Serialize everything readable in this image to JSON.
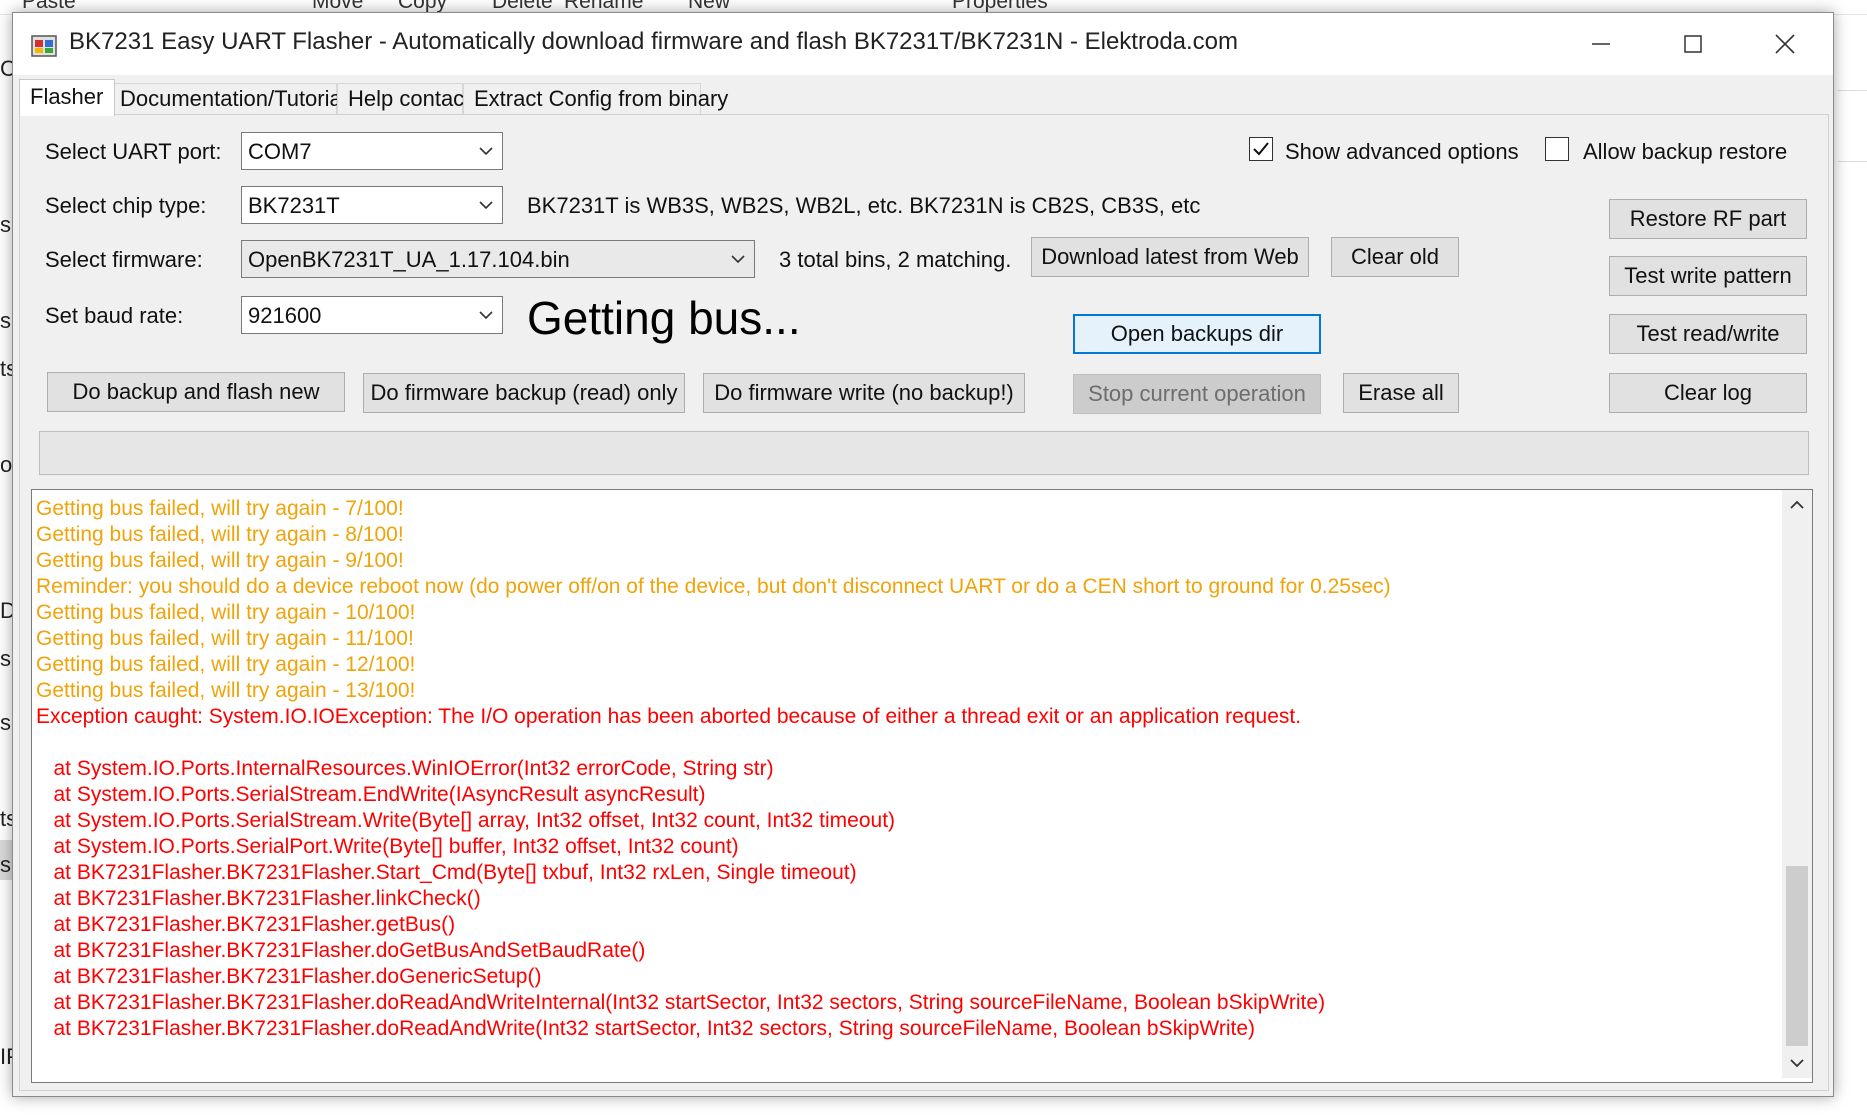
{
  "background": {
    "ribbon_items": [
      "Paste",
      "Move",
      "Copy",
      "Delete",
      "Rename",
      "New",
      "Properties"
    ],
    "left_fragments": [
      "Cl",
      "s",
      "s",
      "ts",
      "ol",
      "D",
      "s",
      "s",
      "ts",
      "s",
      "IP"
    ]
  },
  "window": {
    "title": "BK7231 Easy UART Flasher - Automatically download firmware and flash BK7231T/BK7231N  - Elektroda.com",
    "controls": {
      "minimize": "–",
      "maximize": "☐",
      "close": "✕"
    }
  },
  "tabs": [
    {
      "label": "Flasher",
      "active": true
    },
    {
      "label": "Documentation/Tutorials",
      "active": false
    },
    {
      "label": "Help contact",
      "active": false
    },
    {
      "label": "Extract Config from binary",
      "active": false
    }
  ],
  "form": {
    "uart_label": "Select UART port:",
    "uart_value": "COM7",
    "chip_label": "Select chip type:",
    "chip_value": "BK7231T",
    "chip_info": "BK7231T is WB3S, WB2S, WB2L, etc. BK7231N is CB2S, CB3S, etc",
    "firmware_label": "Select firmware:",
    "firmware_value": "OpenBK7231T_UA_1.17.104.bin",
    "bins_info": "3 total bins, 2 matching.",
    "baud_label": "Set baud rate:",
    "baud_value": "921600",
    "status_text": "Getting bus..."
  },
  "options": {
    "show_advanced": {
      "label": "Show advanced options",
      "checked": true
    },
    "allow_restore": {
      "label": "Allow backup restore",
      "checked": false
    }
  },
  "buttons": {
    "download_latest": "Download latest from Web",
    "clear_old": "Clear old",
    "open_backups": "Open backups dir",
    "backup_and_flash": "Do backup and flash new",
    "backup_only": "Do firmware backup (read) only",
    "write_only": "Do firmware write (no backup!)",
    "stop": "Stop current operation",
    "erase_all": "Erase all",
    "restore_rf": "Restore RF part",
    "test_write": "Test write pattern",
    "test_read_write": "Test read/write",
    "clear_log": "Clear log"
  },
  "log": [
    {
      "text": "Getting bus failed, will try again - 7/100!",
      "color": "orange"
    },
    {
      "text": "Getting bus failed, will try again - 8/100!",
      "color": "orange"
    },
    {
      "text": "Getting bus failed, will try again - 9/100!",
      "color": "orange"
    },
    {
      "text": "Reminder: you should do a device reboot now (do power off/on of the device, but don't disconnect UART or do a CEN short to ground for 0.25sec)",
      "color": "orange"
    },
    {
      "text": "Getting bus failed, will try again - 10/100!",
      "color": "orange"
    },
    {
      "text": "Getting bus failed, will try again - 11/100!",
      "color": "orange"
    },
    {
      "text": "Getting bus failed, will try again - 12/100!",
      "color": "orange"
    },
    {
      "text": "Getting bus failed, will try again - 13/100!",
      "color": "orange"
    },
    {
      "text": "Exception caught: System.IO.IOException: The I/O operation has been aborted because of either a thread exit or an application request.",
      "color": "red"
    },
    {
      "text": "",
      "color": "red"
    },
    {
      "text": "   at System.IO.Ports.InternalResources.WinIOError(Int32 errorCode, String str)",
      "color": "red"
    },
    {
      "text": "   at System.IO.Ports.SerialStream.EndWrite(IAsyncResult asyncResult)",
      "color": "red"
    },
    {
      "text": "   at System.IO.Ports.SerialStream.Write(Byte[] array, Int32 offset, Int32 count, Int32 timeout)",
      "color": "red"
    },
    {
      "text": "   at System.IO.Ports.SerialPort.Write(Byte[] buffer, Int32 offset, Int32 count)",
      "color": "red"
    },
    {
      "text": "   at BK7231Flasher.BK7231Flasher.Start_Cmd(Byte[] txbuf, Int32 rxLen, Single timeout)",
      "color": "red"
    },
    {
      "text": "   at BK7231Flasher.BK7231Flasher.linkCheck()",
      "color": "red"
    },
    {
      "text": "   at BK7231Flasher.BK7231Flasher.getBus()",
      "color": "red"
    },
    {
      "text": "   at BK7231Flasher.BK7231Flasher.doGetBusAndSetBaudRate()",
      "color": "red"
    },
    {
      "text": "   at BK7231Flasher.BK7231Flasher.doGenericSetup()",
      "color": "red"
    },
    {
      "text": "   at BK7231Flasher.BK7231Flasher.doReadAndWriteInternal(Int32 startSector, Int32 sectors, String sourceFileName, Boolean bSkipWrite)",
      "color": "red"
    },
    {
      "text": "   at BK7231Flasher.BK7231Flasher.doReadAndWrite(Int32 startSector, Int32 sectors, String sourceFileName, Boolean bSkipWrite)",
      "color": "red"
    }
  ],
  "colors": {
    "orange": "#f0a30a",
    "red": "#ff0000",
    "accent": "#0078d7"
  }
}
